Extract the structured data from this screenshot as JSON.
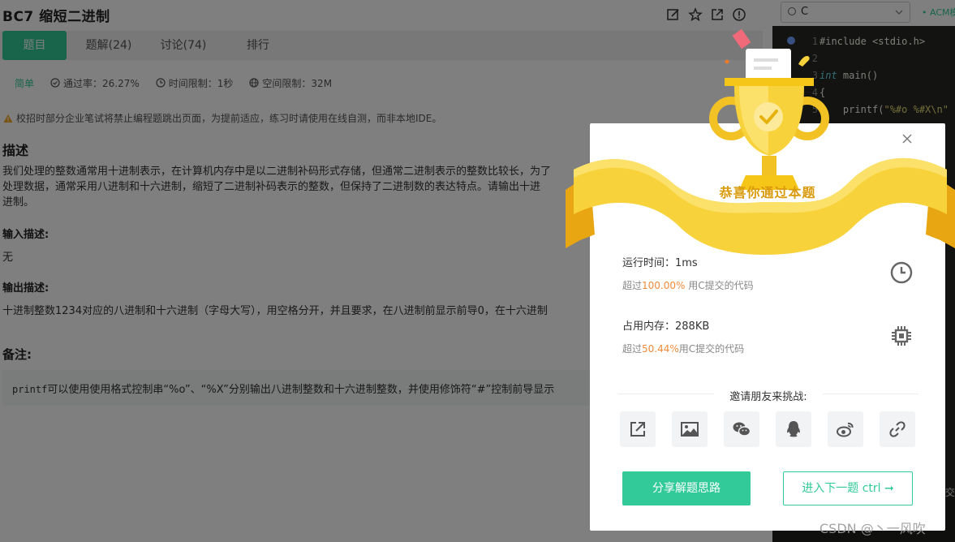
{
  "problem": {
    "title": "BC7  缩短二进制",
    "tabs": [
      {
        "label": "题目",
        "active": true
      },
      {
        "label": "题解(24)",
        "active": false
      },
      {
        "label": "讨论(74)",
        "active": false
      },
      {
        "label": "排行",
        "active": false
      }
    ],
    "meta": {
      "difficulty": "简单",
      "pass_rate": "通过率：26.27%",
      "time_limit": "时间限制：1秒",
      "mem_limit": "空间限制：32M"
    },
    "warning": "校招时部分企业笔试将禁止编程题跳出页面，为提前适应，练习时请使用在线自测，而非本地IDE。",
    "desc_heading": "描述",
    "desc_lines": [
      "我们处理的整数通常用十进制表示，在计算机内存中是以二进制补码形式存储，但通常二进制表示的整数比较长，为了",
      "处理数据，通常采用八进制和十六进制，缩短了二进制补码表示的整数，但保持了二进制数的表达特点。请输出十进",
      "进制。"
    ],
    "input_heading": "输入描述:",
    "input_text": "无",
    "output_heading": "输出描述:",
    "output_text": "十进制整数1234对应的八进制和十六进制（字母大写），用空格分开，并且要求，在八进制前显示前导0，在十六进制",
    "note_heading": "备注:",
    "note_code": "printf",
    "note_text": "可以使用使用格式控制串“%o”、“%X”分别输出八进制整数和十六进制整数，并使用修饰符“#”控制前导显示"
  },
  "editor": {
    "language": "C",
    "acm_label": "• ACM模",
    "line_numbers": [
      "1",
      "2",
      "3",
      "4",
      "5"
    ],
    "lines": {
      "l1": "#include <stdio.h>",
      "l3_kw": "int",
      "l3_rest": " main()",
      "l4": "{",
      "l5_fn": "    printf(",
      "l5_str": "\"%#o %#X\\n\""
    },
    "submit_hint": "提交"
  },
  "modal": {
    "banner_text": "恭喜你通过本题",
    "run_time_label": "运行时间：1ms",
    "run_time_prefix": "超过",
    "run_time_pct": "100.00%",
    "run_time_suffix": " 用C提交的代码",
    "memory_label": "占用内存：288KB",
    "memory_prefix": "超过",
    "memory_pct": "50.44%",
    "memory_suffix": "用C提交的代码",
    "invite_text": "邀请朋友来挑战:",
    "share_solution_label": "分享解题思路",
    "next_problem_label": "进入下一题 ctrl ➞"
  },
  "watermark": "CSDN @丶一风吹",
  "icons": [
    "edit-icon",
    "star-icon",
    "external-link-icon",
    "info-icon",
    "warning-icon",
    "clock-icon",
    "chip-icon",
    "share-icon",
    "image-icon",
    "wechat-icon",
    "qq-icon",
    "weibo-icon",
    "link-icon",
    "close-icon",
    "trophy-icon"
  ],
  "colors": {
    "accent": "#32ca99",
    "highlight": "#f08a3a",
    "gold": "#f5c518"
  }
}
